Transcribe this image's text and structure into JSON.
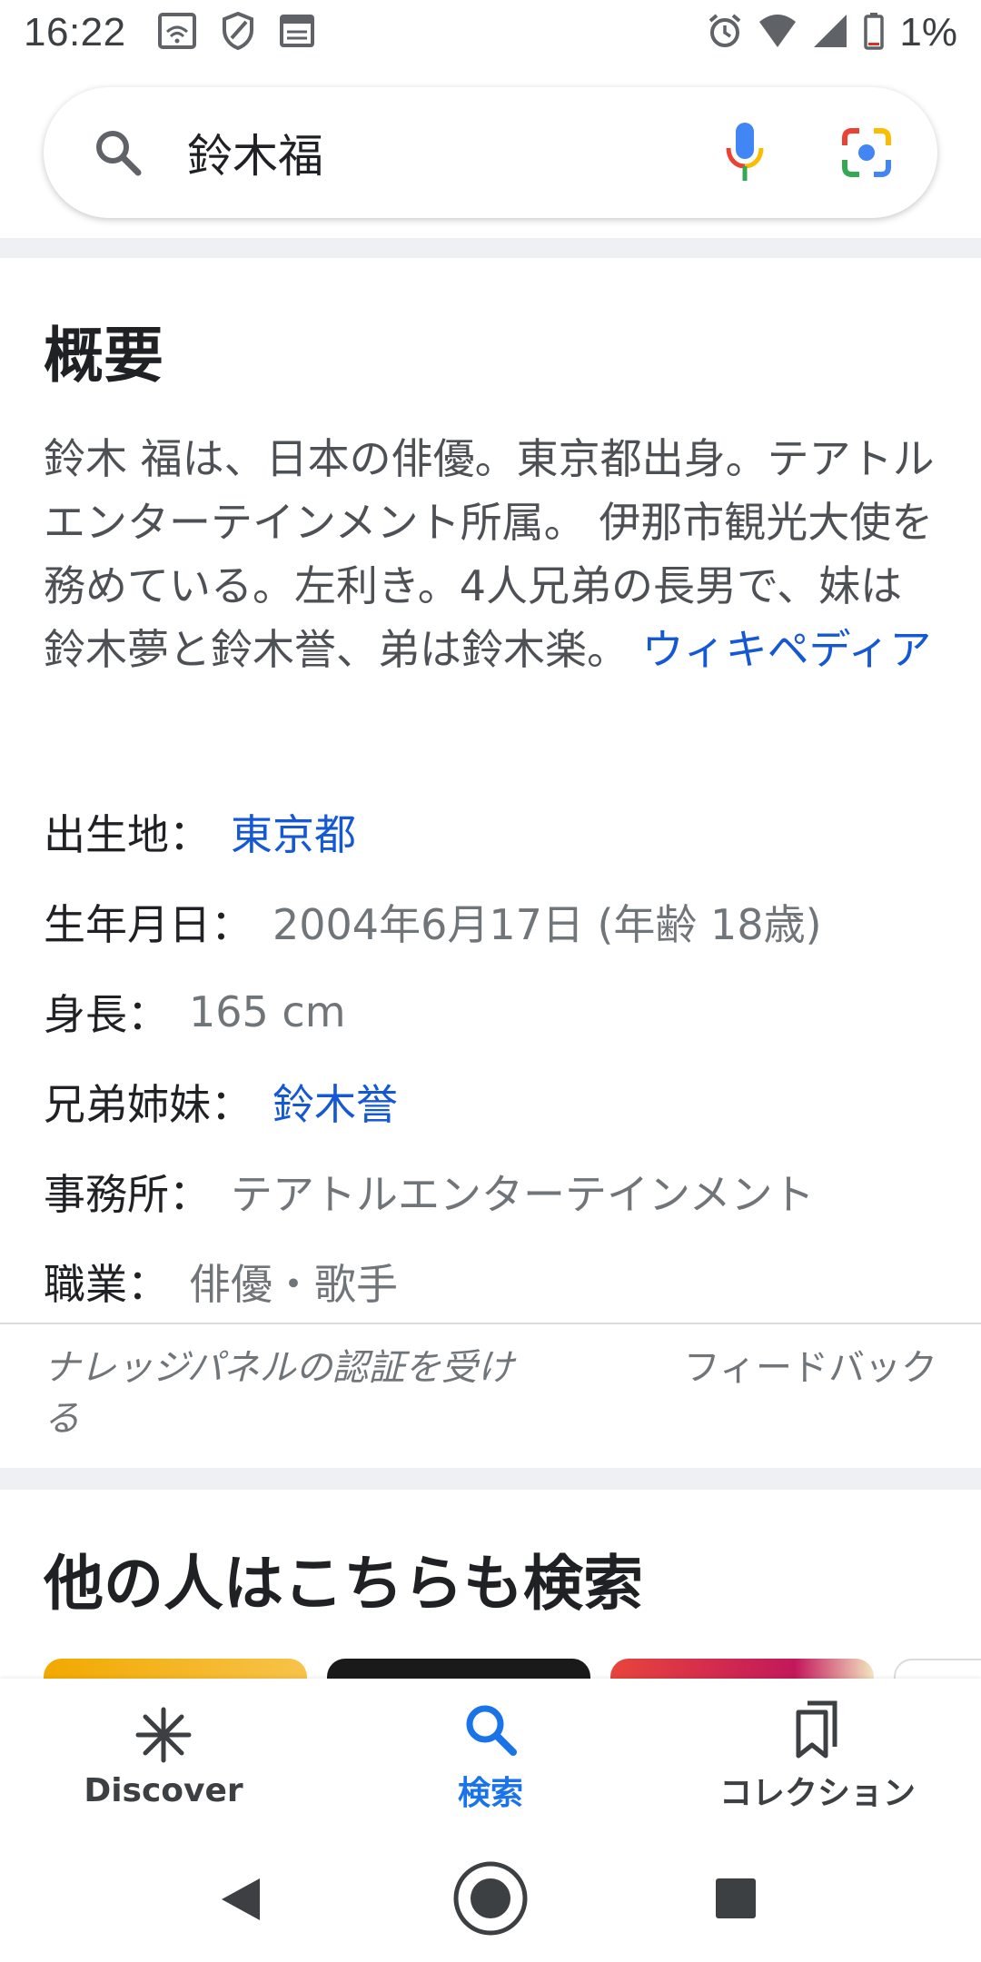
{
  "status_bar": {
    "time": "16:22",
    "battery": "1%",
    "left_icons": [
      "wifi-card-icon",
      "shield-icon",
      "news-icon"
    ],
    "right_icons": [
      "alarm-icon",
      "wifi-icon",
      "signal-icon",
      "battery-icon"
    ]
  },
  "search": {
    "query": "鈴木福"
  },
  "knowledge": {
    "title": "概要",
    "description": "鈴木 福は、日本の俳優。東京都出身。テアトルエンターテインメント所属。 伊那市観光大使を務めている。左利き。4人兄弟の長男で、妹は鈴木夢と鈴木誉、弟は鈴木楽。",
    "source_link": "ウィキペディア",
    "facts": [
      {
        "label": "出生地",
        "value": "東京都",
        "link": true
      },
      {
        "label": "生年月日",
        "value": "2004年6月17日 (年齢 18歳)",
        "link": false
      },
      {
        "label": "身長",
        "value": "165 cm",
        "link": false
      },
      {
        "label": "兄弟姉妹",
        "value": "鈴木誉",
        "link": true
      },
      {
        "label": "事務所",
        "value": "テアトルエンターテインメント",
        "link": false
      },
      {
        "label": "職業",
        "value": "俳優・歌手",
        "link": false
      }
    ],
    "separator": "：",
    "claim_text": "ナレッジパネルの認証を受ける",
    "feedback_text": "フィードバック"
  },
  "people_also_search": {
    "title": "他の人はこちらも検索"
  },
  "bottom_nav": {
    "items": [
      {
        "label": "Discover",
        "icon": "asterisk-icon",
        "active": false
      },
      {
        "label": "検索",
        "icon": "search-icon",
        "active": true
      },
      {
        "label": "コレクション",
        "icon": "bookmarks-icon",
        "active": false
      }
    ]
  },
  "colors": {
    "link": "#1558d6",
    "active_nav": "#1a73e8",
    "text": "#202124",
    "muted": "#70757a"
  }
}
